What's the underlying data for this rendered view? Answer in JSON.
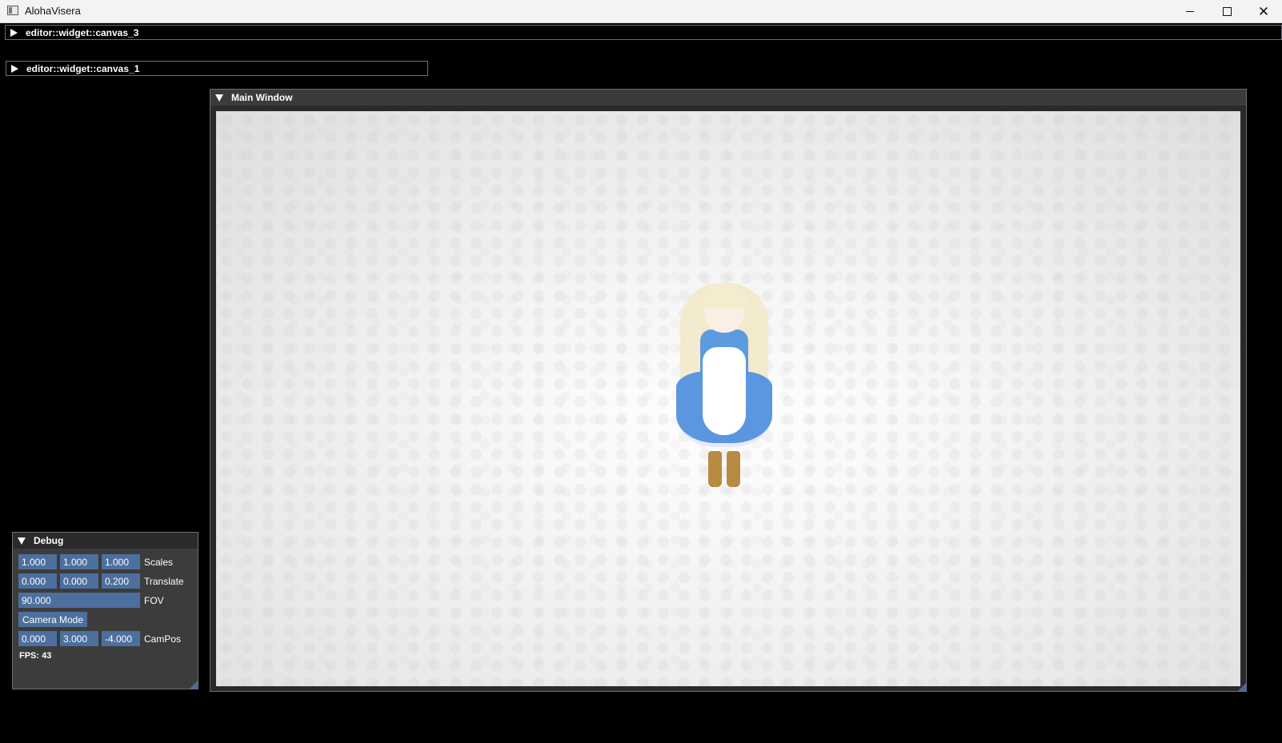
{
  "window": {
    "title": "AlohaVisera"
  },
  "headers": {
    "canvas3": "editor::widget::canvas_3",
    "canvas1": "editor::widget::canvas_1"
  },
  "main_window": {
    "title": "Main Window"
  },
  "debug": {
    "title": "Debug",
    "scales": {
      "label": "Scales",
      "values": [
        "1.000",
        "1.000",
        "1.000"
      ]
    },
    "translate": {
      "label": "Translate",
      "values": [
        "0.000",
        "0.000",
        "0.200"
      ]
    },
    "fov": {
      "label": "FOV",
      "value": "90.000"
    },
    "camera_mode": {
      "label": "Camera Mode"
    },
    "campos": {
      "label": "CamPos",
      "values": [
        "0.000",
        "3.000",
        "-4.000"
      ]
    },
    "fps": "FPS: 43"
  },
  "colors": {
    "field_bg": "#4c6f9e",
    "window_bg": "#3c3c3c",
    "titlebar_bg": "#f3f3f3"
  },
  "icons": [
    "app-icon",
    "minimize-icon",
    "maximize-icon",
    "close-icon",
    "expand-arrow-icon",
    "collapse-arrow-icon",
    "resize-grip-icon"
  ]
}
